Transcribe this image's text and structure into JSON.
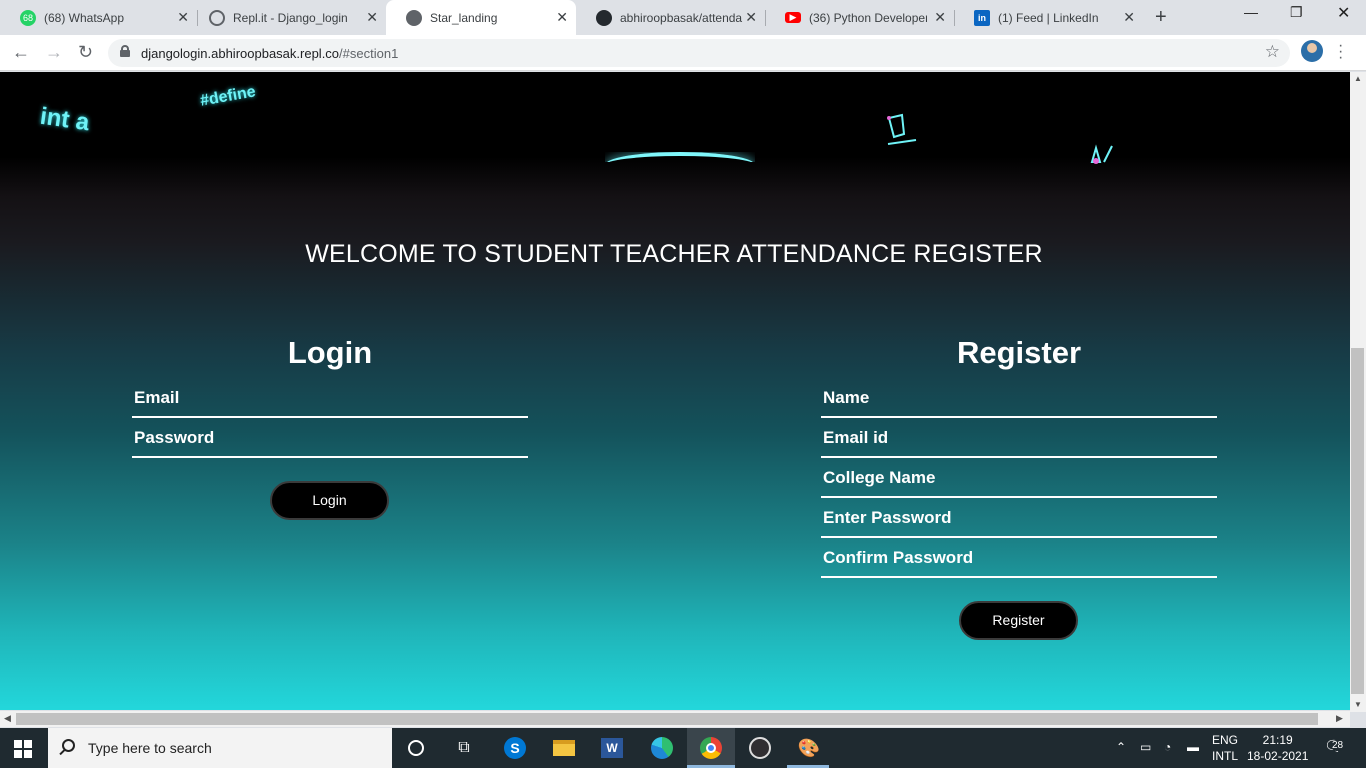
{
  "browser": {
    "tabs": [
      {
        "title": "(68) WhatsApp",
        "favicon": "whatsapp-icon",
        "badge": "68",
        "color": "#25d366"
      },
      {
        "title": "Repl.it - Django_login",
        "favicon": "replit-icon",
        "color": "#5f6368"
      },
      {
        "title": "Star_landing",
        "favicon": "globe-icon",
        "color": "#5f6368",
        "active": true
      },
      {
        "title": "abhiroopbasak/attenda",
        "favicon": "github-icon",
        "color": "#24292e"
      },
      {
        "title": "(36) Python Developer",
        "favicon": "youtube-icon",
        "color": "#ff0000"
      },
      {
        "title": "(1) Feed | LinkedIn",
        "favicon": "linkedin-icon",
        "color": "#0a66c2"
      }
    ],
    "url_host": "djangologin.abhiroopbasak.repl.co",
    "url_rest": "/#section1"
  },
  "page": {
    "doodles": [
      "int a",
      "#define"
    ],
    "welcome": "WELCOME TO STUDENT TEACHER ATTENDANCE REGISTER",
    "login": {
      "title": "Login",
      "email_placeholder": "Email",
      "password_placeholder": "Password",
      "button": "Login"
    },
    "register": {
      "title": "Register",
      "name_placeholder": "Name",
      "email_placeholder": "Email id",
      "college_placeholder": "College Name",
      "password_placeholder": "Enter Password",
      "confirm_placeholder": "Confirm Password",
      "button": "Register"
    }
  },
  "taskbar": {
    "search_placeholder": "Type here to search",
    "language": "ENG",
    "layout": "INTL",
    "time": "21:19",
    "date": "18-02-2021",
    "notifications": "28"
  }
}
